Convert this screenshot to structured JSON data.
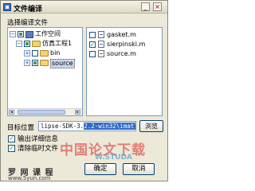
{
  "window": {
    "title": "文件编译",
    "minimize_glyph": "_",
    "close_glyph": "×"
  },
  "section_label": "选择编译文件",
  "tree": {
    "root": {
      "label": "工作空间",
      "expander": "−",
      "checked": "partial"
    },
    "project": {
      "label": "仿真工程1",
      "expander": "−",
      "checked": "partial"
    },
    "folders": [
      {
        "label": "bin",
        "expander": "+",
        "checked": false,
        "selected": false
      },
      {
        "label": "source",
        "expander": "+",
        "checked": "partial",
        "selected": true
      }
    ]
  },
  "files": [
    {
      "label": "gasket.m",
      "checked": false
    },
    {
      "label": "sierpinski.m",
      "checked": true
    },
    {
      "label": "source.m",
      "checked": false
    }
  ],
  "target": {
    "label": "目标位置",
    "value_prefix": "lipse-SDK-3.",
    "value_selected": "2.2-win32\\imatla",
    "browse_label": "浏览"
  },
  "options": [
    {
      "label": "输出详细信息",
      "checked": true
    },
    {
      "label": "清除临时文件",
      "checked": true
    }
  ],
  "buttons": {
    "ok": "确定",
    "cancel": "取消"
  },
  "footer": {
    "brand": "罗 网 课 程",
    "url": "www.5yun.com"
  },
  "watermark": {
    "text": "中国论文下载",
    "url": "W.STUDA"
  },
  "icons": {
    "app": "app-icon",
    "workspace": "workspace-icon",
    "project": "project-icon",
    "folder": "folder-icon",
    "file": "m-file-icon"
  }
}
